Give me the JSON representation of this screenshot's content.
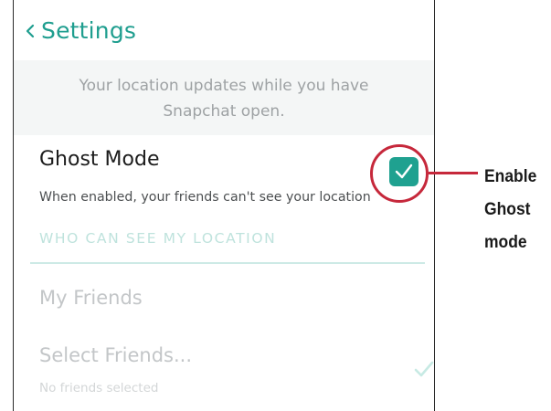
{
  "nav": {
    "back_title": "Settings"
  },
  "banner": {
    "line1": "Your location updates while you have",
    "line2": "Snapchat open."
  },
  "ghost_mode": {
    "title": "Ghost Mode",
    "description": "When enabled, your friends can't see your location",
    "enabled": true
  },
  "section": {
    "header": "WHO CAN SEE MY LOCATION"
  },
  "options": {
    "my_friends": "My Friends",
    "select_friends": "Select Friends...",
    "select_friends_sub": "No friends selected"
  },
  "callout": {
    "line1": "Enable",
    "line2": "Ghost",
    "line3": "mode"
  },
  "colors": {
    "accent": "#1fa190",
    "callout": "#c6283b"
  }
}
